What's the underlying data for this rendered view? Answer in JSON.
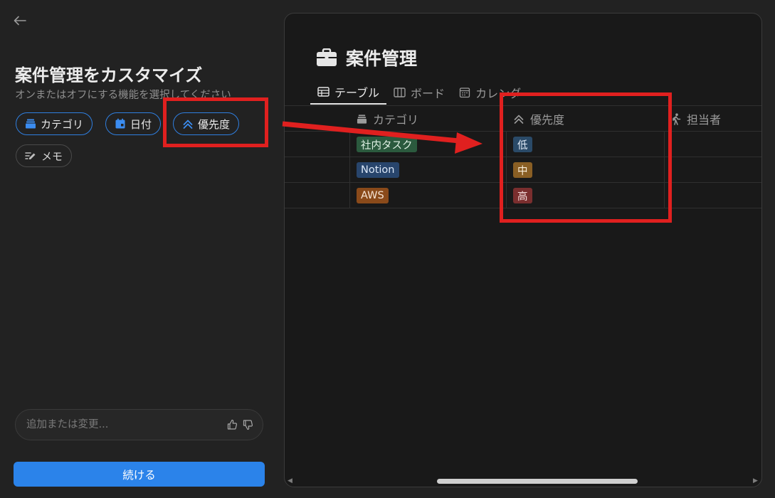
{
  "left": {
    "heading": "案件管理をカスタマイズ",
    "subheading": "オンまたはオフにする機能を選択してください",
    "chips": [
      {
        "label": "カテゴリ",
        "icon": "stack-icon",
        "state": "on"
      },
      {
        "label": "日付",
        "icon": "calendar-icon",
        "state": "on"
      },
      {
        "label": "優先度",
        "icon": "double-chevron-up-icon",
        "state": "on"
      },
      {
        "label": "メモ",
        "icon": "edit-lines-icon",
        "state": "off"
      }
    ],
    "input_placeholder": "追加または変更...",
    "continue_label": "続ける"
  },
  "preview": {
    "title": "案件管理",
    "tabs": [
      {
        "label": "テーブル",
        "icon": "table-icon",
        "active": true
      },
      {
        "label": "ボード",
        "icon": "board-icon",
        "active": false
      },
      {
        "label": "カレンダー",
        "icon": "calendar-icon",
        "active": false
      }
    ],
    "columns": [
      "カテゴリ",
      "優先度",
      "担当者"
    ],
    "rows": [
      {
        "category": "社内タスク",
        "priority": "低"
      },
      {
        "category": "Notion",
        "priority": "中"
      },
      {
        "category": "AWS",
        "priority": "高"
      }
    ]
  },
  "colors": {
    "accent": "#2b83ea",
    "annotation_red": "#e0201f",
    "tag_green": "#2b5a3e",
    "tag_blue": "#28456c",
    "tag_orange": "#8a4a1a",
    "tag_low": "#2a4a68",
    "tag_mid": "#8a5f24",
    "tag_high": "#7a2e2e"
  }
}
